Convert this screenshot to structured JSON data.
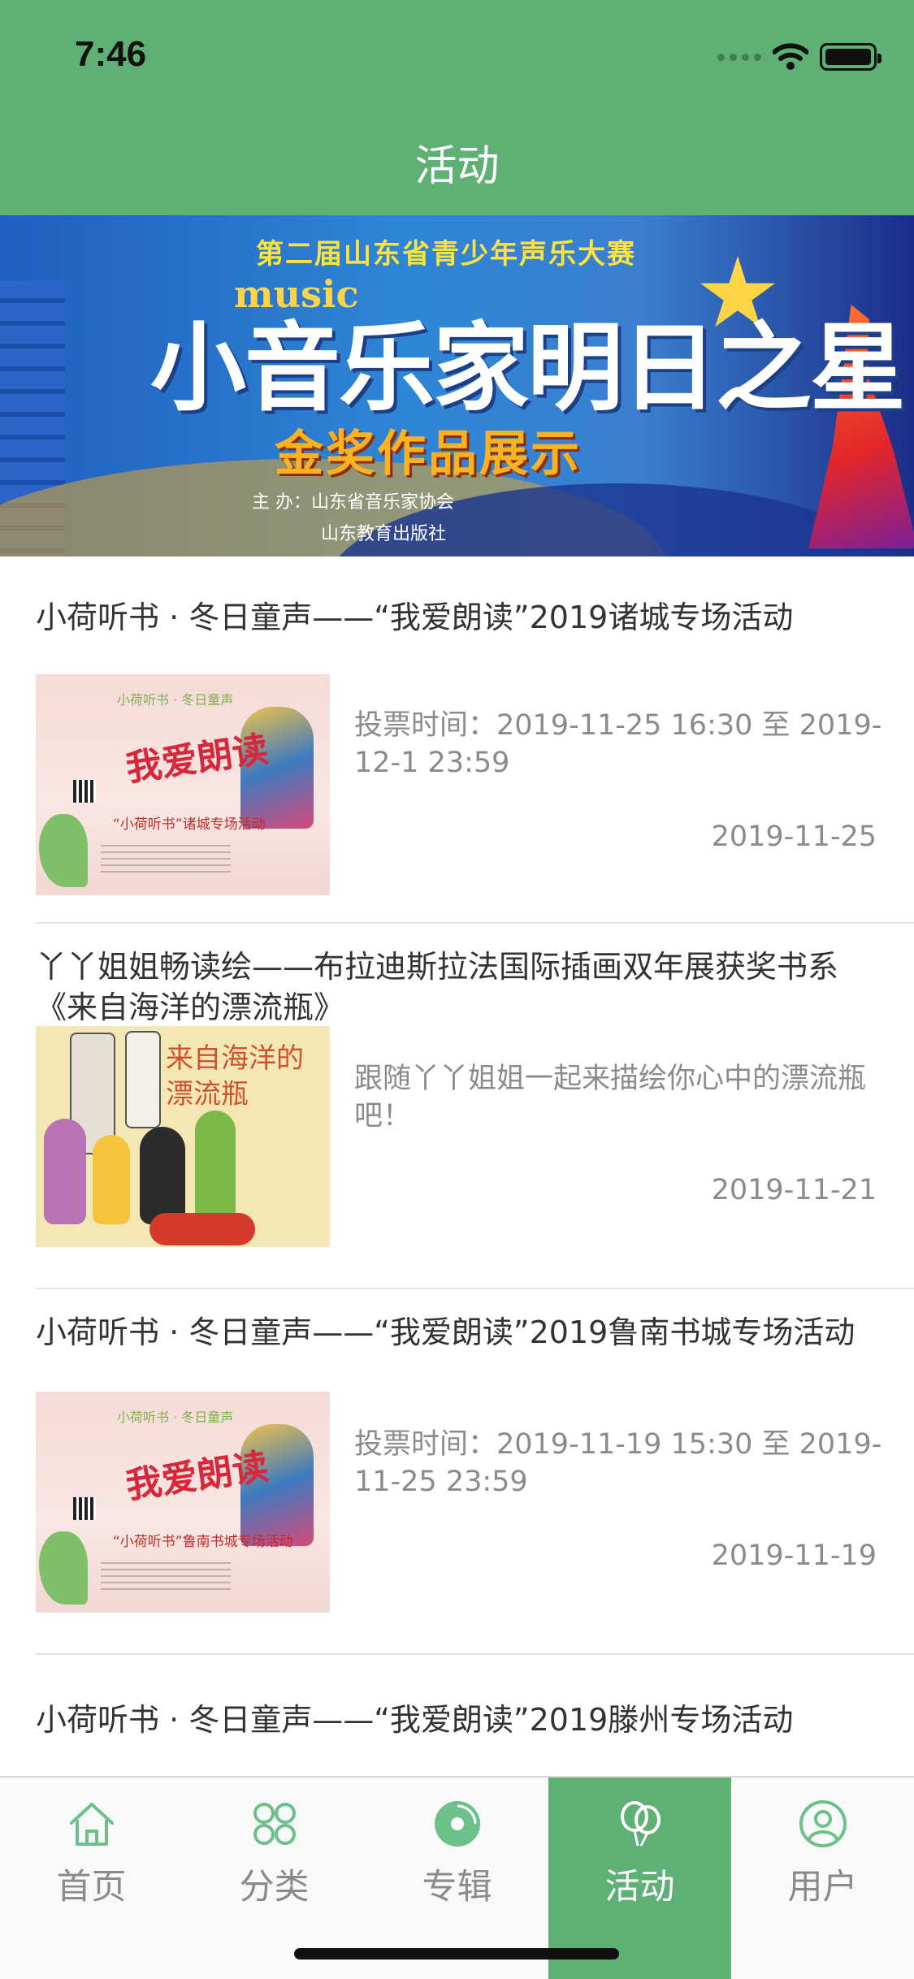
{
  "status": {
    "time": "7:46"
  },
  "header": {
    "title": "活动"
  },
  "banner": {
    "subtitle": "第二届山东省青少年声乐大赛",
    "music": "music",
    "headline": "小音乐家明日之星",
    "gold_text": "金奖作品展示",
    "organizer_line1": "主  办：山东省音乐家协会",
    "organizer_line2": "山东教育出版社"
  },
  "activities": [
    {
      "title": "小荷听书 · 冬日童声——“我爱朗读”2019诸城专场活动",
      "description": "投票时间：2019-11-25 16:30 至 2019-12-1 23:59",
      "date": "2019-11-25",
      "poster_top": "小荷听书 · 冬日童声",
      "poster_main": "我爱朗读",
      "poster_sub": "“小荷听书”诸城专场活动"
    },
    {
      "title": "丫丫姐姐畅读绘——布拉迪斯拉法国际插画双年展获奖书系《来自海洋的漂流瓶》",
      "description": "跟随丫丫姐姐一起来描绘你心中的漂流瓶吧！",
      "date": "2019-11-21",
      "poster_main": "来自海洋的漂流瓶"
    },
    {
      "title": "小荷听书 · 冬日童声——“我爱朗读”2019鲁南书城专场活动",
      "description": "投票时间：2019-11-19 15:30 至 2019-11-25 23:59",
      "date": "2019-11-19",
      "poster_top": "小荷听书 · 冬日童声",
      "poster_main": "我爱朗读",
      "poster_sub": "“小荷听书”鲁南书城专场活动"
    },
    {
      "title": "小荷听书 · 冬日童声——“我爱朗读”2019滕州专场活动"
    }
  ],
  "tabbar": {
    "items": [
      {
        "label": "首页",
        "icon": "home-icon"
      },
      {
        "label": "分类",
        "icon": "category-icon"
      },
      {
        "label": "专辑",
        "icon": "album-icon"
      },
      {
        "label": "活动",
        "icon": "activity-icon",
        "active": true
      },
      {
        "label": "用户",
        "icon": "user-icon"
      }
    ]
  },
  "colors": {
    "brand_green": "#5fb075",
    "text": "#333333",
    "secondary_text": "#8b8b8b"
  }
}
